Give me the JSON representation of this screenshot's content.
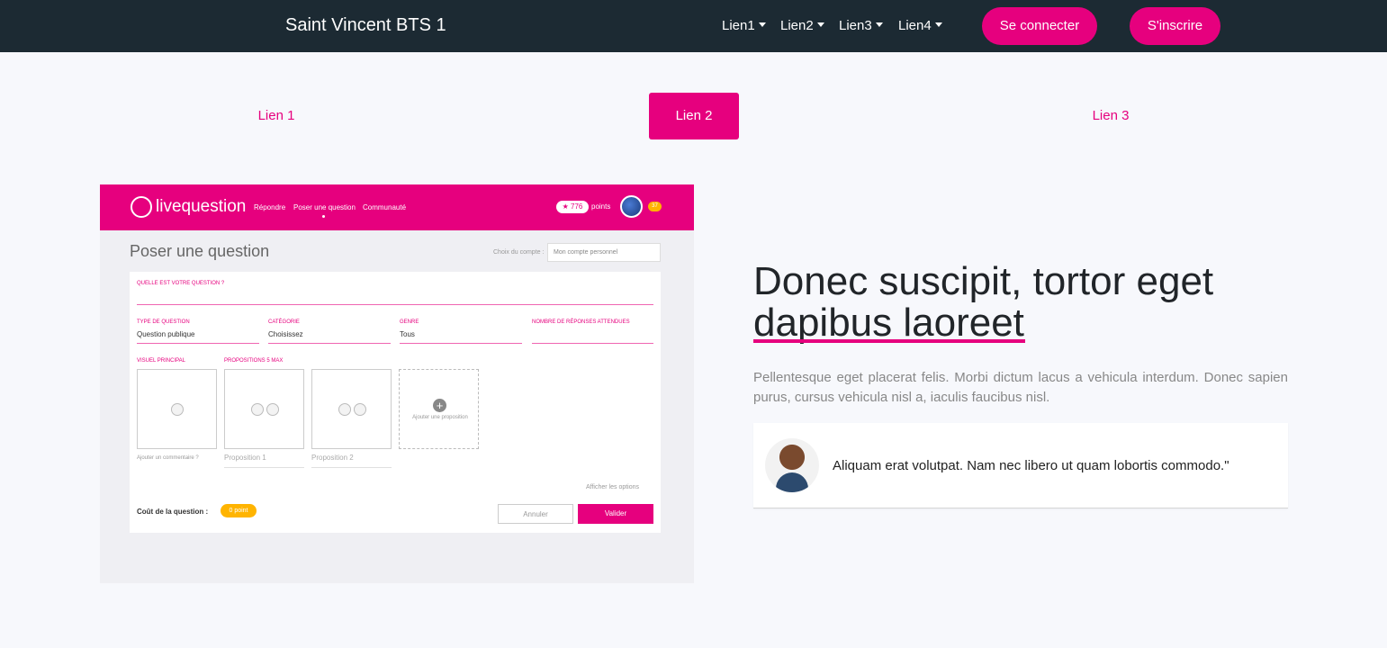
{
  "navbar": {
    "brand": "Saint Vincent BTS 1",
    "links": [
      "Lien1",
      "Lien2",
      "Lien3",
      "Lien4"
    ],
    "login": "Se connecter",
    "signup": "S'inscrire"
  },
  "tabs": [
    "Lien 1",
    "Lien 2",
    "Lien 3"
  ],
  "active_tab": "Lien 2",
  "mock": {
    "logo": "livequestion",
    "nav": [
      "Répondre",
      "Poser une question",
      "Communauté"
    ],
    "points_value": "★ 776",
    "points_label": "points",
    "badge": "37",
    "title": "Poser une question",
    "account_label": "Choix du compte :",
    "account_value": "Mon compte personnel",
    "question_label": "QUELLE EST VOTRE QUESTION ?",
    "type_label": "TYPE DE QUESTION",
    "type_value": "Question publique",
    "category_label": "CATÉGORIE",
    "category_value": "Choisissez",
    "genre_label": "GENRE",
    "genre_value": "Tous",
    "responses_label": "NOMBRE DE RÉPONSES ATTENDUES",
    "visual_label": "VISUEL PRINCIPAL",
    "proposals_label": "PROPOSITIONS 5 MAX",
    "add_comment": "Ajouter un commentaire ?",
    "proposal1": "Proposition 1",
    "proposal2": "Proposition 2",
    "add_proposal": "Ajouter une proposition",
    "show_options": "Afficher les options",
    "cost_label": "Coût de la question :",
    "cost_value": "0 point",
    "cancel": "Annuler",
    "validate": "Valider"
  },
  "content": {
    "heading": "Donec suscipit, tortor eget dapibus laoreet",
    "paragraph": "Pellentesque eget placerat felis. Morbi dictum lacus a vehicula interdum. Donec sapien purus, cursus vehicula nisl a, iaculis faucibus nisl.",
    "quote": "Aliquam erat volutpat. Nam nec libero ut quam lobortis commodo.\""
  },
  "colors": {
    "navbar": "#1c2a33",
    "accent": "#e6007e",
    "background": "#f7f8fc"
  }
}
